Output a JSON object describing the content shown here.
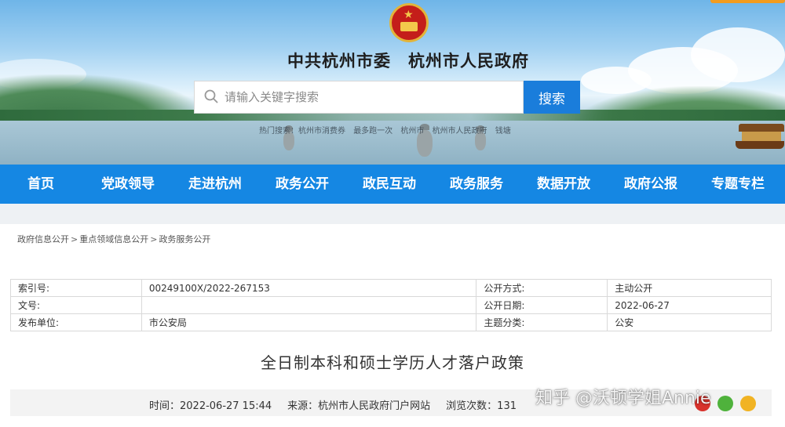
{
  "header": {
    "site_title": "中共杭州市委　杭州市人民政府",
    "search_placeholder": "请输入关键字搜索",
    "search_button": "搜索",
    "quick_links": [
      "热门搜索：杭州市消费券",
      "最多跑一次",
      "杭州市",
      "杭州市人民政府",
      "钱塘"
    ]
  },
  "nav": {
    "items": [
      "首页",
      "党政领导",
      "走进杭州",
      "政务公开",
      "政民互动",
      "政务服务",
      "数据开放",
      "政府公报",
      "专题专栏"
    ]
  },
  "breadcrumb": {
    "items": [
      "政府信息公开",
      "重点领域信息公开",
      "政务服务公开"
    ],
    "separator": ">"
  },
  "meta": {
    "index_label": "索引号:",
    "index_value": "00249100X/2022-267153",
    "disclosure_method_label": "公开方式:",
    "disclosure_method_value": "主动公开",
    "doc_number_label": "文号:",
    "doc_number_value": "",
    "publish_date_label": "公开日期:",
    "publish_date_value": "2022-06-27",
    "issuer_label": "发布单位:",
    "issuer_value": "市公安局",
    "topic_label": "主题分类:",
    "topic_value": "公安"
  },
  "article": {
    "title": "全日制本科和硕士学历人才落户政策",
    "time_text": "时间：2022-06-27 15:44",
    "source_text": "来源：杭州市人民政府门户网站",
    "views_text": "浏览次数：131"
  },
  "watermark": "知乎 @沃顿学姐Annie",
  "colors": {
    "nav_bg": "#1587e3",
    "search_button": "#1a7ddb",
    "share_weibo": "#d8322c",
    "share_wechat": "#4fb23c",
    "share_qzone": "#f1b323"
  }
}
